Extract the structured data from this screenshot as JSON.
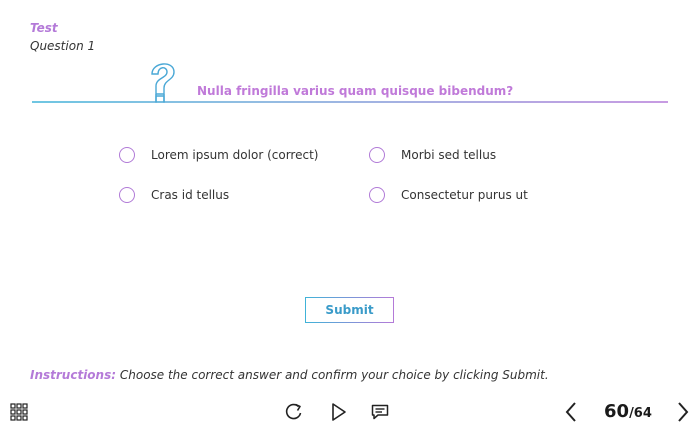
{
  "quiz": {
    "title": "Test",
    "subtitle": "Question 1",
    "question": "Nulla fringilla varius quam quisque bibendum?",
    "options": [
      {
        "label": "Lorem ipsum dolor (correct)",
        "selected": false
      },
      {
        "label": "Morbi sed tellus",
        "selected": false
      },
      {
        "label": "Cras id tellus",
        "selected": false
      },
      {
        "label": "Consectetur purus ut",
        "selected": false
      }
    ],
    "submit_label": "Submit"
  },
  "instructions": {
    "label": "Instructions:",
    "text": " Choose the correct answer and confirm your choice by clicking Submit."
  },
  "toolbar": {
    "menu_icon": "grid-menu-icon",
    "replay_icon": "replay-icon",
    "play_icon": "play-icon",
    "comments_icon": "comment-icon",
    "prev_icon": "chevron-left-icon",
    "next_icon": "chevron-right-icon",
    "page_current": "60",
    "page_total": "/64"
  },
  "colors": {
    "accent_purple": "#b47ad8",
    "accent_blue": "#3fb3d8"
  }
}
